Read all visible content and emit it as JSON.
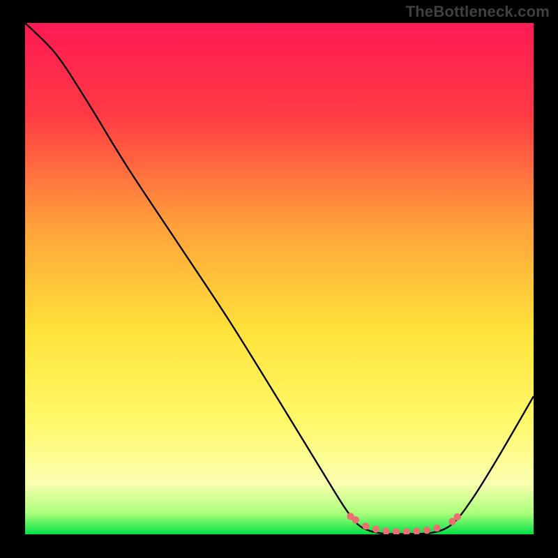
{
  "watermark": "TheBottleneck.com",
  "chart_data": {
    "type": "line",
    "title": "",
    "xlabel": "",
    "ylabel": "",
    "xlim": [
      0,
      100
    ],
    "ylim": [
      0,
      100
    ],
    "gradient_stops": [
      {
        "offset": 0,
        "color": "#ff1a55"
      },
      {
        "offset": 18,
        "color": "#ff3a44"
      },
      {
        "offset": 40,
        "color": "#ffa23a"
      },
      {
        "offset": 60,
        "color": "#ffe23a"
      },
      {
        "offset": 78,
        "color": "#fff96a"
      },
      {
        "offset": 90,
        "color": "#faffb0"
      },
      {
        "offset": 96,
        "color": "#a8ff7a"
      },
      {
        "offset": 100,
        "color": "#00e246"
      }
    ],
    "series": [
      {
        "name": "bottleneck-curve",
        "points": [
          {
            "x": 0,
            "y": 100
          },
          {
            "x": 6,
            "y": 94
          },
          {
            "x": 12,
            "y": 85
          },
          {
            "x": 20,
            "y": 72
          },
          {
            "x": 30,
            "y": 57
          },
          {
            "x": 40,
            "y": 42
          },
          {
            "x": 50,
            "y": 26
          },
          {
            "x": 58,
            "y": 13
          },
          {
            "x": 63,
            "y": 5
          },
          {
            "x": 66,
            "y": 1.5
          },
          {
            "x": 70,
            "y": 0.2
          },
          {
            "x": 75,
            "y": 0.1
          },
          {
            "x": 80,
            "y": 0.3
          },
          {
            "x": 84,
            "y": 2
          },
          {
            "x": 88,
            "y": 7
          },
          {
            "x": 93,
            "y": 15
          },
          {
            "x": 100,
            "y": 27
          }
        ]
      }
    ],
    "markers": [
      {
        "x": 64,
        "y": 3.5
      },
      {
        "x": 65,
        "y": 2.8
      },
      {
        "x": 67,
        "y": 1.6
      },
      {
        "x": 69,
        "y": 1.0
      },
      {
        "x": 71,
        "y": 0.6
      },
      {
        "x": 73,
        "y": 0.5
      },
      {
        "x": 75,
        "y": 0.5
      },
      {
        "x": 77,
        "y": 0.6
      },
      {
        "x": 79,
        "y": 0.8
      },
      {
        "x": 81,
        "y": 1.2
      },
      {
        "x": 84,
        "y": 2.5
      },
      {
        "x": 85,
        "y": 3.4
      }
    ]
  }
}
